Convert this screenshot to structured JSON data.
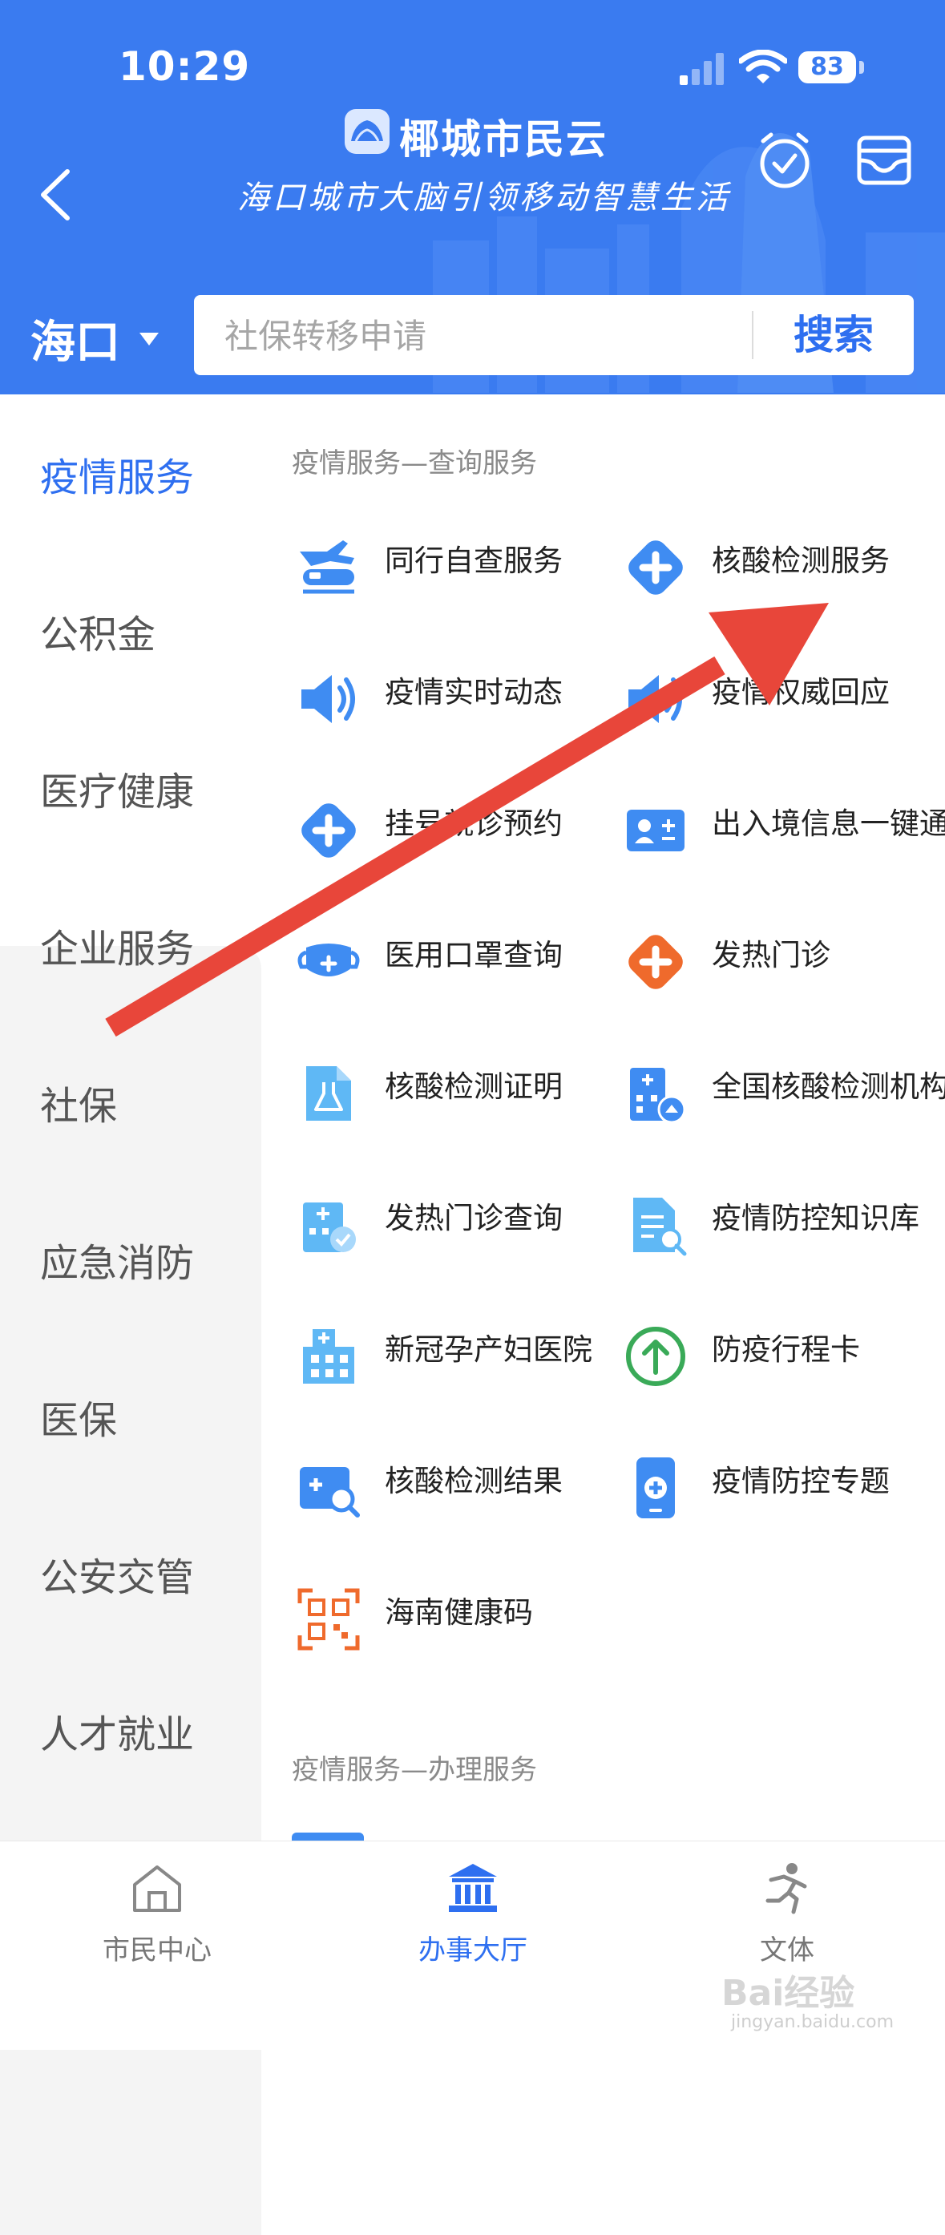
{
  "status_bar": {
    "time": "10:29",
    "battery": "83"
  },
  "header": {
    "app_name": "椰城市民云",
    "slogan": "海口城市大脑引领移动智慧生活",
    "city": "海口",
    "search": {
      "placeholder": "社保转移申请",
      "button": "搜索"
    }
  },
  "colors": {
    "brand": "#3a7bf0",
    "accent_text": "#2e6ff0",
    "arrow": "#e8463a"
  },
  "sidebar": {
    "items": [
      {
        "label": "疫情服务",
        "active": true
      },
      {
        "label": "公积金"
      },
      {
        "label": "医疗健康"
      },
      {
        "label": "企业服务"
      },
      {
        "label": "社保"
      },
      {
        "label": "应急消防"
      },
      {
        "label": "医保"
      },
      {
        "label": "公安交管"
      },
      {
        "label": "人才就业"
      }
    ]
  },
  "content": {
    "section1_title": "疫情服务—查询服务",
    "section2_title": "疫情服务—办理服务",
    "services": [
      {
        "label": "同行自查服务",
        "icon": "train-plane-icon"
      },
      {
        "label": "核酸检测服务",
        "icon": "medical-cross-icon"
      },
      {
        "label": "疫情实时动态",
        "icon": "speaker-icon"
      },
      {
        "label": "疫情权威回应",
        "icon": "speaker-icon"
      },
      {
        "label": "挂号就诊预约",
        "icon": "medical-cross-icon"
      },
      {
        "label": "出入境信息一键通",
        "icon": "id-card-icon"
      },
      {
        "label": "医用口罩查询",
        "icon": "mask-icon"
      },
      {
        "label": "发热门诊",
        "icon": "medical-cross-orange-icon"
      },
      {
        "label": "核酸检测证明",
        "icon": "document-flask-icon"
      },
      {
        "label": "全国核酸检测机构",
        "icon": "hospital-building-icon"
      },
      {
        "label": "发热门诊查询",
        "icon": "hospital-check-icon"
      },
      {
        "label": "疫情防控知识库",
        "icon": "document-search-icon"
      },
      {
        "label": "新冠孕产妇医院",
        "icon": "hospital-icon"
      },
      {
        "label": "防疫行程卡",
        "icon": "arrow-up-circle-icon"
      },
      {
        "label": "核酸检测结果",
        "icon": "test-result-search-icon"
      },
      {
        "label": "疫情防控专题",
        "icon": "phone-medical-icon"
      },
      {
        "label": "海南健康码",
        "icon": "qr-code-icon"
      }
    ]
  },
  "bottom_nav": [
    {
      "label": "市民中心",
      "icon": "home-icon"
    },
    {
      "label": "办事大厅",
      "icon": "government-hall-icon",
      "active": true
    },
    {
      "label": "文体",
      "icon": "running-person-icon"
    }
  ],
  "watermark": {
    "brand": "Bai经验",
    "site": "jingyan.baidu.com"
  }
}
